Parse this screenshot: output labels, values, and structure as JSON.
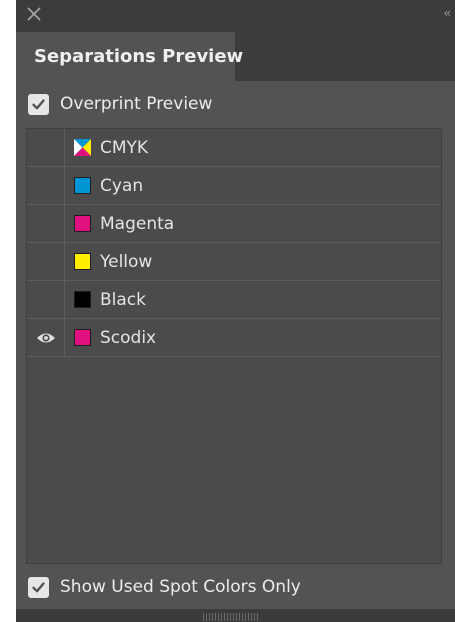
{
  "panel": {
    "tab_label": "Separations Preview"
  },
  "overprint_preview": {
    "label": "Overprint Preview",
    "checked": true
  },
  "separations": [
    {
      "label": "CMYK",
      "color": "composite",
      "visible": false
    },
    {
      "label": "Cyan",
      "color": "#0096d6",
      "visible": false
    },
    {
      "label": "Magenta",
      "color": "#e0117f",
      "visible": false
    },
    {
      "label": "Yellow",
      "color": "#ffee00",
      "visible": false
    },
    {
      "label": "Black",
      "color": "#000000",
      "visible": false
    },
    {
      "label": "Scodix",
      "color": "#e0117f",
      "visible": true
    }
  ],
  "show_used_spot_colors": {
    "label": "Show Used Spot Colors Only",
    "checked": true
  },
  "icons": {
    "close": "close-icon",
    "collapse": "collapse-icon",
    "eye": "eye-icon",
    "check": "check-icon"
  }
}
